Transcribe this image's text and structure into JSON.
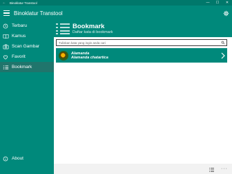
{
  "window": {
    "title": "Binoklatur Transtool",
    "back_glyph": "←",
    "minimize_glyph": "—",
    "maximize_glyph": "☐",
    "close_glyph": "✕"
  },
  "appbar": {
    "title": "Binoklatur Transtool",
    "menu_icon": "hamburger-icon",
    "settings_icon": "gear-icon"
  },
  "sidebar": {
    "items": [
      {
        "label": "Terbaru",
        "icon": "clock-icon"
      },
      {
        "label": "Kamus",
        "icon": "book-icon"
      },
      {
        "label": "Scan Gambar",
        "icon": "camera-icon"
      },
      {
        "label": "Favorit",
        "icon": "heart-icon"
      },
      {
        "label": "Bookmark",
        "icon": "bookmark-list-icon",
        "active": true
      }
    ],
    "about": {
      "label": "About",
      "icon": "info-icon"
    }
  },
  "header": {
    "title": "Bookmark",
    "subtitle": "Daftar kata di bookmark",
    "icon": "list-icon"
  },
  "search": {
    "placeholder": "Tuliskan kata yang ingin anda cari",
    "icon": "search-icon"
  },
  "entries": [
    {
      "name": "Alamanda",
      "latin": "Alamanda chatartica",
      "icon": "chevron-right-icon"
    }
  ],
  "bottombar": {
    "view_icon": "list-view-icon",
    "more": "···"
  },
  "colors": {
    "accent": "#00897b",
    "active_item": "#20756c",
    "titlebar": "#00786b"
  }
}
